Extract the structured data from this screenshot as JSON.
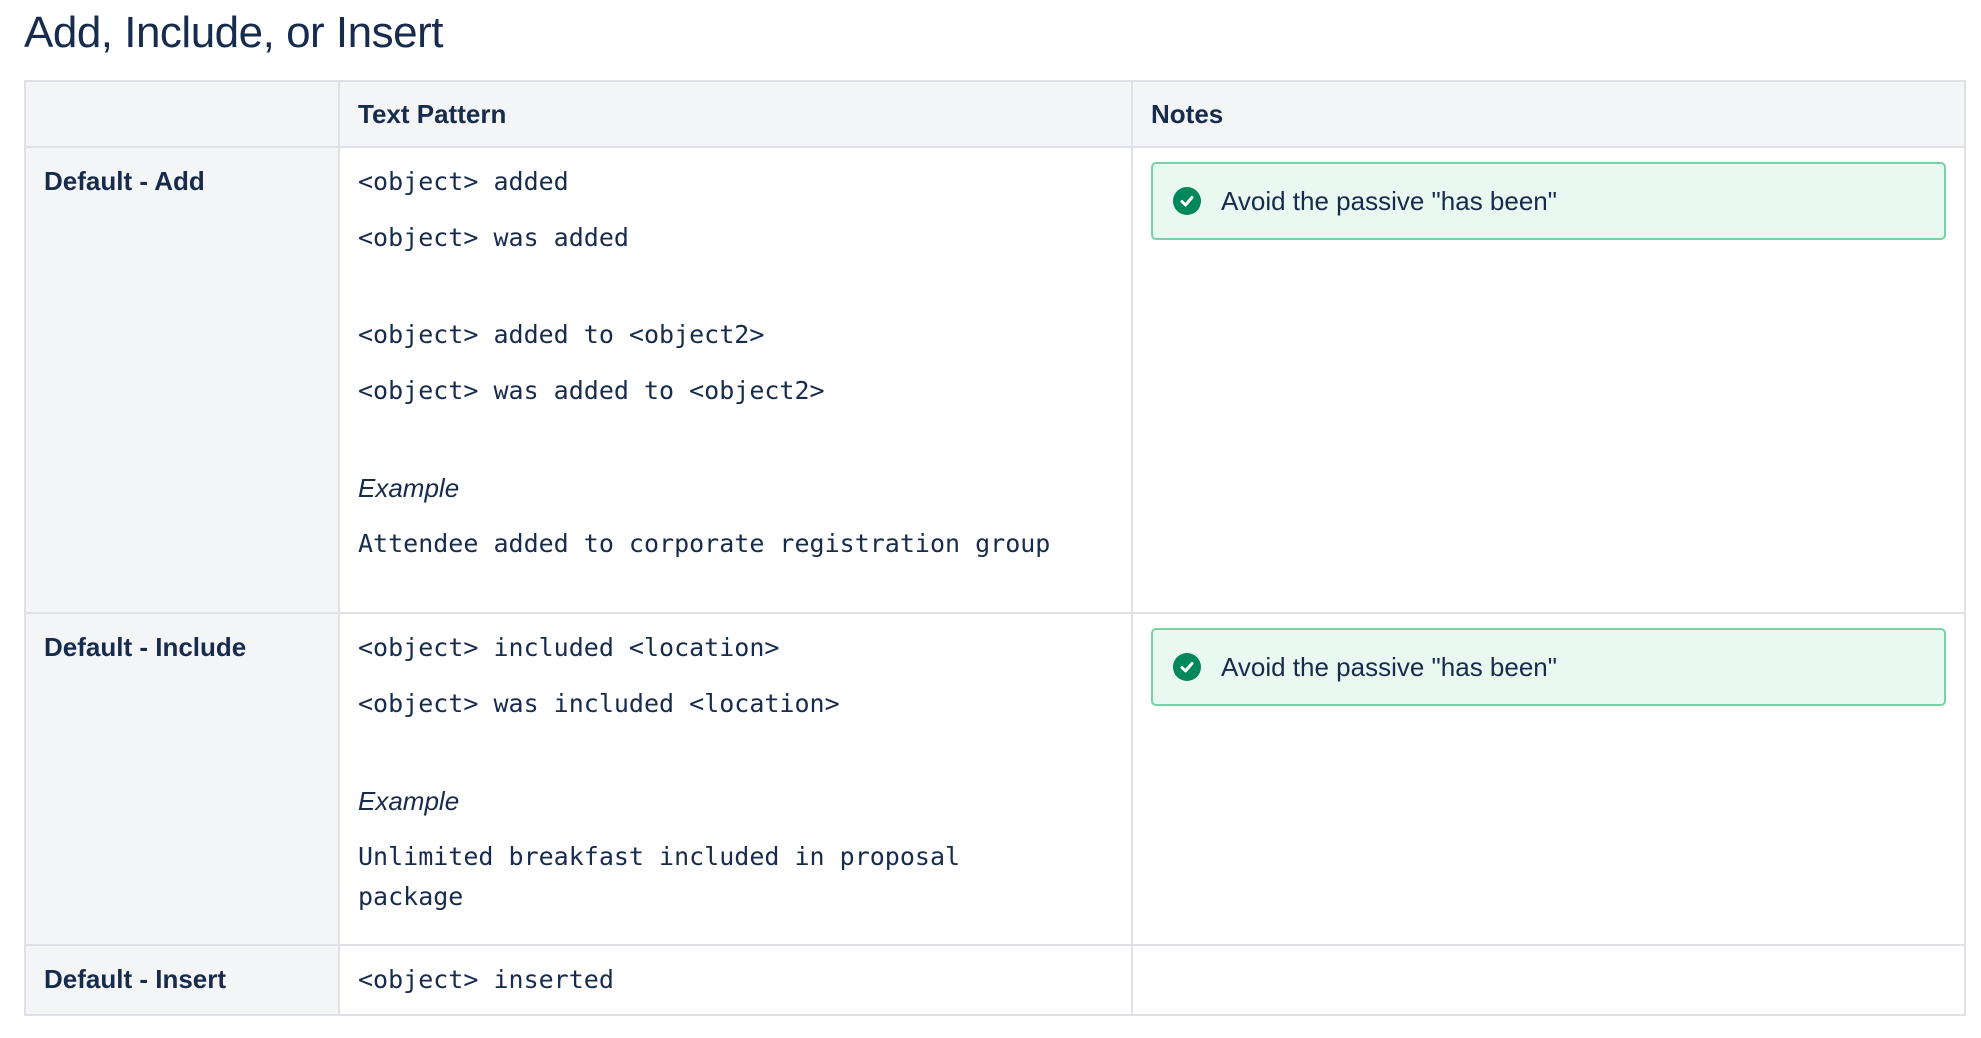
{
  "title": "Add, Include, or Insert",
  "table": {
    "headers": [
      "",
      "Text Pattern",
      "Notes"
    ],
    "rows": [
      {
        "label": "Default - Add",
        "patterns_a": [
          "<object> added",
          "<object> was added"
        ],
        "patterns_b": [
          "<object> added to <object2>",
          "<object> was added to <object2>"
        ],
        "example_label": "Example",
        "example": "Attendee added to corporate registration group",
        "note": "Avoid the passive \"has been\""
      },
      {
        "label": "Default - Include",
        "patterns_a": [
          "<object> included <location>",
          "<object> was included <location>"
        ],
        "example_label": "Example",
        "example": "Unlimited breakfast included in proposal package",
        "note": "Avoid the passive \"has been\""
      },
      {
        "label": "Default - Insert",
        "patterns_a": [
          "<object> inserted"
        ]
      }
    ]
  },
  "colors": {
    "text": "#172b4d",
    "header_bg": "#f4f5f7",
    "border": "#dfe1e6",
    "note_bg": "#e9f8f0",
    "note_border": "#79d1a6",
    "success": "#00875a"
  },
  "icons": {
    "note": "check-circle-icon"
  }
}
